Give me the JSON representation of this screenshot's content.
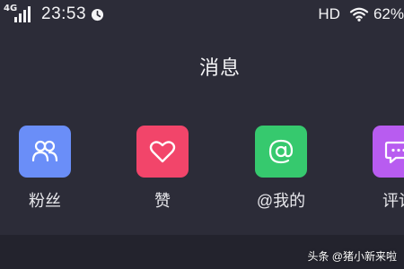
{
  "status_bar": {
    "network_type": "4G",
    "time": "23:53",
    "hd_label": "HD",
    "battery": "62%"
  },
  "header": {
    "title": "消息"
  },
  "categories": [
    {
      "label": "粉丝",
      "icon": "fans-icon",
      "color": "#6a8ef8"
    },
    {
      "label": "赞",
      "icon": "heart-icon",
      "color": "#f2456a"
    },
    {
      "label": "@我的",
      "icon": "at-icon",
      "color": "#36c96e"
    },
    {
      "label": "评论",
      "icon": "comment-icon",
      "color": "#b85cf0"
    }
  ],
  "watermark": "头条 @猪小新来啦"
}
